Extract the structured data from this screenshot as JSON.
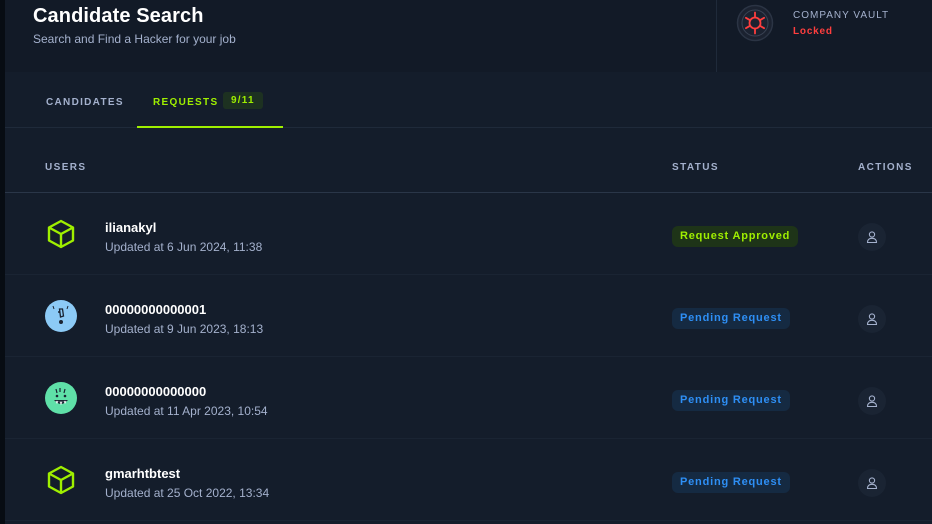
{
  "header": {
    "title": "Candidate Search",
    "subtitle": "Search and Find a Hacker for your job",
    "vault": {
      "label": "COMPANY VAULT",
      "status": "Locked",
      "icon": "vault-wheel-icon"
    }
  },
  "tabs": [
    {
      "label": "CANDIDATES",
      "active": false
    },
    {
      "label": "REQUESTS",
      "count": "9/11",
      "active": true
    }
  ],
  "table": {
    "columns": {
      "users": "USERS",
      "status": "STATUS",
      "actions": "ACTIONS"
    },
    "rows": [
      {
        "name": "ilianakyl",
        "updated": "Updated at 6 Jun 2024, 11:38",
        "status": "Request Approved",
        "status_type": "approved",
        "avatar": "green-cube-icon"
      },
      {
        "name": "00000000000001",
        "updated": "Updated at 9 Jun 2023, 18:13",
        "status": "Pending Request",
        "status_type": "pending",
        "avatar": "blue-face-avatar"
      },
      {
        "name": "00000000000000",
        "updated": "Updated at 11 Apr 2023, 10:54",
        "status": "Pending Request",
        "status_type": "pending",
        "avatar": "green-monster-avatar"
      },
      {
        "name": "gmarhtbtest",
        "updated": "Updated at 25 Oct 2022, 13:34",
        "status": "Pending Request",
        "status_type": "pending",
        "avatar": "green-cube-icon"
      }
    ],
    "action_icon": "user-icon"
  },
  "colors": {
    "accent": "#9fef00",
    "pending": "#2e8ff5",
    "locked": "#ff3e3e",
    "background": "#141d2b"
  }
}
